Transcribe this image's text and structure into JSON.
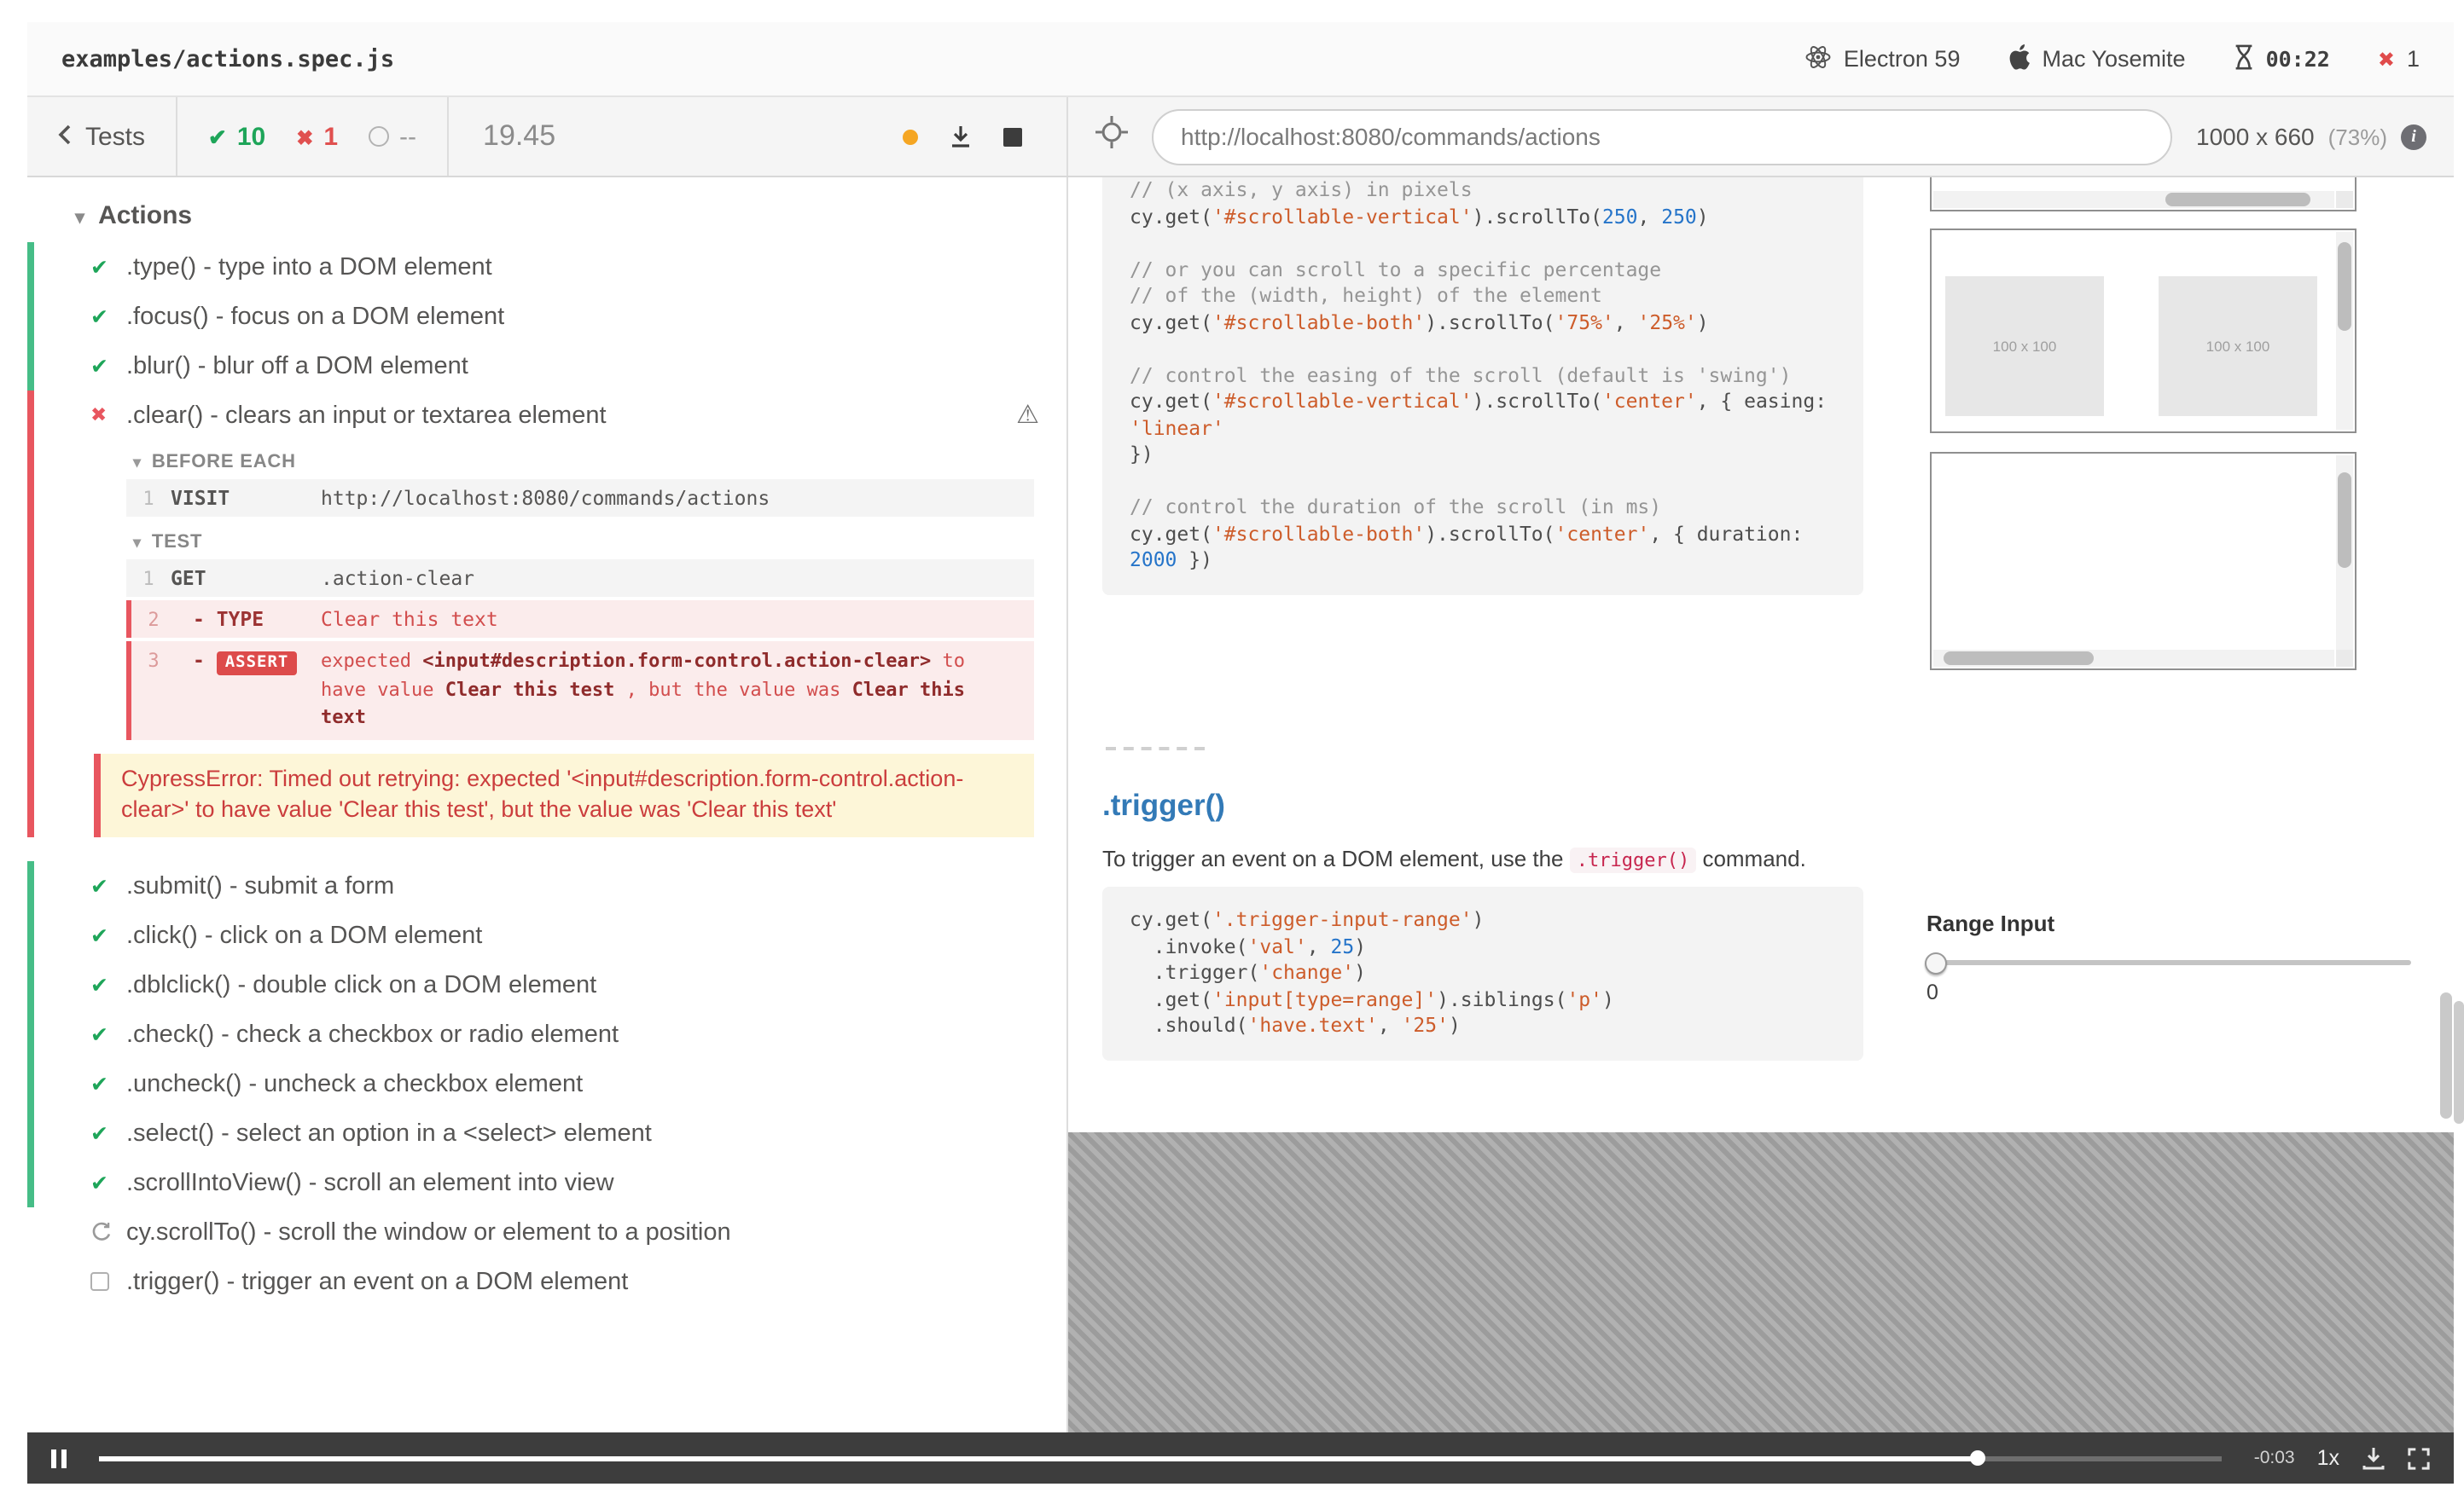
{
  "colors": {
    "pass_green": "#1ea559",
    "fail_red": "#e8565f",
    "heading_blue": "#337ab7",
    "warn_orange": "#f5a623"
  },
  "icons": {
    "status_passed": "check",
    "status_failed": "x",
    "status_running": "spinner",
    "status_pending": "empty-box",
    "failed_attention": "warning-triangle"
  },
  "header": {
    "spec": "examples/actions.spec.js",
    "browser": "Electron 59",
    "os": "Mac Yosemite",
    "timer": "00:22",
    "failures": "1"
  },
  "toolbar": {
    "back_label": "Tests",
    "passed_count": "10",
    "failed_count": "1",
    "pending_count": "--",
    "duration": "19.45",
    "url": "http://localhost:8080/commands/actions",
    "viewport_size": "1000 x 660",
    "viewport_zoom": "(73%)"
  },
  "reporter": {
    "suite_title": "Actions",
    "tests_before": [
      ".type() - type into a DOM element",
      ".focus() - focus on a DOM element",
      ".blur() - blur off a DOM element"
    ],
    "failed_test": {
      "title": ".clear() - clears an input or textarea element",
      "before_each_label": "BEFORE EACH",
      "visit_row": {
        "n": "1",
        "cmd": "VISIT",
        "msg": "http://localhost:8080/commands/actions"
      },
      "test_label": "TEST",
      "get_row": {
        "n": "1",
        "cmd": "GET",
        "msg": ".action-clear"
      },
      "type_row": {
        "n": "2",
        "cmd": "- TYPE",
        "msg": "Clear this text"
      },
      "assert_row": {
        "n": "3",
        "dash": "- ",
        "badge": "ASSERT",
        "t1": "expected ",
        "b1": "<input#description.form-control.action-clear>",
        "t2": " to have value ",
        "b2": "Clear this test",
        "t3": " , but the value was ",
        "b3": "Clear this text"
      },
      "error": "CypressError: Timed out retrying: expected '<input#description.form-control.action-clear>' to have value 'Clear this test', but the value was 'Clear this text'"
    },
    "tests_after": [
      ".submit() - submit a form",
      ".click() - click on a DOM element",
      ".dblclick() - double click on a DOM element",
      ".check() - check a checkbox or radio element",
      ".uncheck() - uncheck a checkbox element",
      ".select() - select an option in a <select> element",
      ".scrollIntoView() - scroll an element into view"
    ],
    "running_test": "cy.scrollTo() - scroll the window or element to a position",
    "pending_test": ".trigger() - trigger an event on a DOM element"
  },
  "aut": {
    "code1": {
      "lines": [
        [
          [
            "c",
            "// (x axis, y axis) in pixels"
          ]
        ],
        [
          [
            "p",
            "cy.get("
          ],
          [
            "s",
            "'#scrollable-vertical'"
          ],
          [
            "p",
            ").scrollTo("
          ],
          [
            "n",
            "250"
          ],
          [
            "p",
            ", "
          ],
          [
            "n",
            "250"
          ],
          [
            "p",
            ")"
          ]
        ],
        [],
        [
          [
            "c",
            "// or you can scroll to a specific percentage"
          ]
        ],
        [
          [
            "c",
            "// of the (width, height) of the element"
          ]
        ],
        [
          [
            "p",
            "cy.get("
          ],
          [
            "s",
            "'#scrollable-both'"
          ],
          [
            "p",
            ").scrollTo("
          ],
          [
            "s",
            "'75%'"
          ],
          [
            "p",
            ", "
          ],
          [
            "s",
            "'25%'"
          ],
          [
            "p",
            ")"
          ]
        ],
        [],
        [
          [
            "c",
            "// control the easing of the scroll (default is 'swing')"
          ]
        ],
        [
          [
            "p",
            "cy.get("
          ],
          [
            "s",
            "'#scrollable-vertical'"
          ],
          [
            "p",
            ").scrollTo("
          ],
          [
            "s",
            "'center'"
          ],
          [
            "p",
            ", { easing: "
          ],
          [
            "s",
            "'linear'"
          ]
        ],
        [
          [
            "p",
            "})"
          ]
        ],
        [],
        [
          [
            "c",
            "// control the duration of the scroll (in ms)"
          ]
        ],
        [
          [
            "p",
            "cy.get("
          ],
          [
            "s",
            "'#scrollable-both'"
          ],
          [
            "p",
            ").scrollTo("
          ],
          [
            "s",
            "'center'"
          ],
          [
            "p",
            ", { duration: "
          ],
          [
            "n",
            "2000"
          ],
          [
            "p",
            " })"
          ]
        ]
      ]
    },
    "placeholder_label": "100 x 100",
    "trigger": {
      "heading": ".trigger()",
      "desc_pre": "To trigger an event on a DOM element, use the ",
      "desc_code": ".trigger()",
      "desc_post": " command.",
      "code": {
        "lines": [
          [
            [
              "p",
              "cy.get("
            ],
            [
              "s",
              "'.trigger-input-range'"
            ],
            [
              "p",
              ")"
            ]
          ],
          [
            [
              "p",
              "  .invoke("
            ],
            [
              "s",
              "'val'"
            ],
            [
              "p",
              ", "
            ],
            [
              "n",
              "25"
            ],
            [
              "p",
              ")"
            ]
          ],
          [
            [
              "p",
              "  .trigger("
            ],
            [
              "s",
              "'change'"
            ],
            [
              "p",
              ")"
            ]
          ],
          [
            [
              "p",
              "  .get("
            ],
            [
              "s",
              "'input[type=range]'"
            ],
            [
              "p",
              ").siblings("
            ],
            [
              "s",
              "'p'"
            ],
            [
              "p",
              ")"
            ]
          ],
          [
            [
              "p",
              "  .should("
            ],
            [
              "s",
              "'have.text'"
            ],
            [
              "p",
              ", "
            ],
            [
              "s",
              "'25'"
            ],
            [
              "p",
              ")"
            ]
          ]
        ]
      }
    },
    "range": {
      "label": "Range Input",
      "value": "0"
    }
  },
  "player": {
    "time": "-0:03",
    "speed": "1x"
  }
}
